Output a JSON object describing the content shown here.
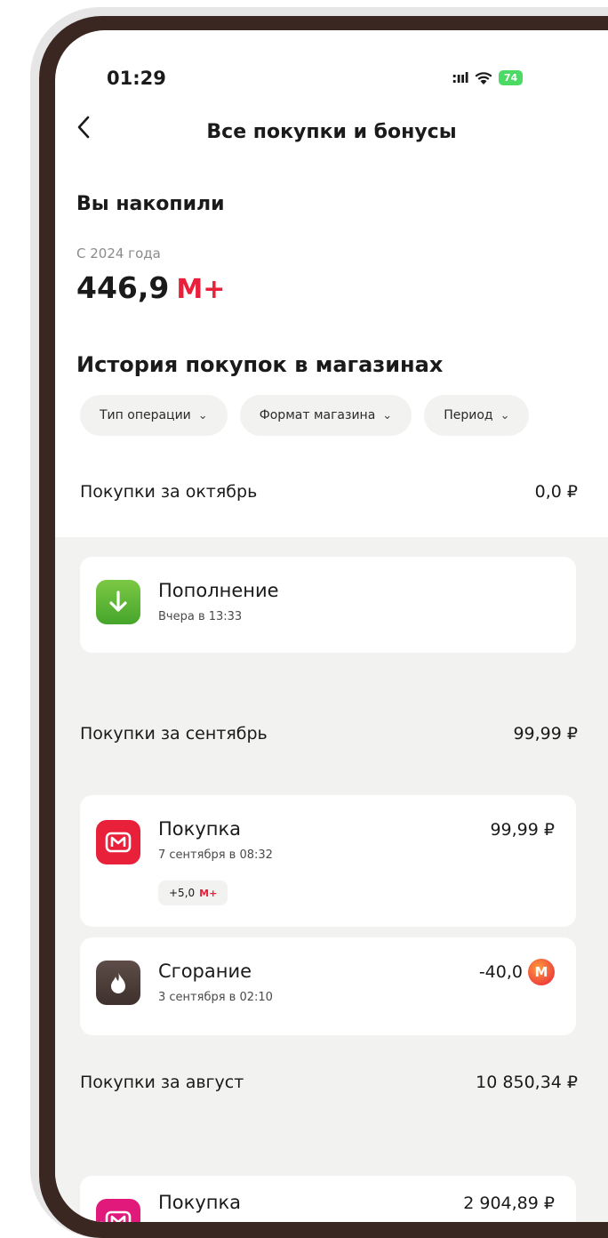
{
  "status_bar": {
    "time": "01:29",
    "signal": ":ııl",
    "battery": "74"
  },
  "header": {
    "title": "Все покупки и бонусы",
    "back_icon": "chevron-left-icon"
  },
  "accumulated": {
    "heading": "Вы накопили",
    "since": "С 2024 года",
    "value": "446,9",
    "unit": "М+"
  },
  "history": {
    "heading": "История покупок в магазинах",
    "filters": [
      {
        "label": "Тип операции"
      },
      {
        "label": "Формат магазина"
      },
      {
        "label": "Период"
      }
    ]
  },
  "sections": [
    {
      "label": "Покупки за октябрь",
      "total": "0,0 ₽",
      "transactions": [
        {
          "icon": "arrow-down-icon",
          "icon_color": "#58b530",
          "title": "Пополнение",
          "subtitle": "Вчера в 13:33",
          "amount": ""
        }
      ]
    },
    {
      "label": "Покупки за сентябрь",
      "total": "99,99 ₽",
      "transactions": [
        {
          "icon": "magnit-logo-icon",
          "icon_color": "#e8203a",
          "title": "Покупка",
          "subtitle": "7 сентября в 08:32",
          "amount": "99,99 ₽",
          "bonus": "+5,0",
          "bonus_unit": "М+"
        },
        {
          "icon": "flame-icon",
          "icon_color": "#4a3a36",
          "title": "Сгорание",
          "subtitle": "3 сентября в 02:10",
          "amount": "-40,0",
          "coin_letter": "M"
        }
      ]
    },
    {
      "label": "Покупки за август",
      "total": "10 850,34 ₽",
      "transactions": [
        {
          "icon": "magnit-cosmetic-logo-icon",
          "icon_color": "#e0197a",
          "title": "Покупка",
          "subtitle": "",
          "amount": "2 904,89 ₽"
        }
      ]
    }
  ],
  "colors": {
    "accent": "#e8203a",
    "background_grey": "#f2f2f0",
    "bezel": "#3a2722"
  }
}
